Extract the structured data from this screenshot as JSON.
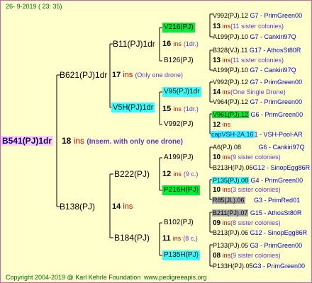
{
  "header": {
    "date": "26- 9-2019 ( 23: 35)"
  },
  "footer": {
    "copyright": "Copyright 2004-2019 @ Karl Kehrle Foundation",
    "site": "www.pedigreeapis.org"
  },
  "colors": {
    "background": "#ffffcc",
    "green_box": "#00ee33",
    "cyan_box": "#33ffff",
    "grey_box": "#aaaaaa",
    "pink_box": "#ffccff",
    "blue_text": "#0000cc",
    "red_text": "#cc0000",
    "purple_text": "#6633cc",
    "green_text": "#33aa33"
  },
  "root": {
    "name": "B541(PJ)1dr",
    "ins": "18",
    "ins_unit": "ins",
    "note": "(Insem. with only one drone)"
  },
  "gen1": [
    {
      "name": "B621(PJ)1dr",
      "ins": "17",
      "ins_unit": "ins",
      "note": "(Only one drone)"
    },
    {
      "name": "B138(PJ)",
      "ins": "14",
      "ins_unit": "ins",
      "note": ""
    }
  ],
  "gen2": [
    {
      "name": "B11(PJ)1dr",
      "ins": "16",
      "ins_unit": "ins",
      "note": "(1dr.)"
    },
    {
      "name": "V5H(PJ)1dr",
      "ins": "15",
      "ins_unit": "ins",
      "note": "(1dr.)"
    },
    {
      "name": "B222(PJ)",
      "ins": "12",
      "ins_unit": "ins",
      "note": "(9 c.)"
    },
    {
      "name": "B184(PJ)",
      "ins": "11",
      "ins_unit": "ins",
      "note": "(8 c.)"
    }
  ],
  "gen3": [
    {
      "name": "V216(PJ)",
      "ins": "13",
      "note": "(11 sister colonies)"
    },
    {
      "name": "B126(PJ)",
      "ins": "13",
      "note": "(11 sister colonies)"
    },
    {
      "name": "V95(PJ)1dr",
      "ins": "14",
      "note": "(One Single Drone)"
    },
    {
      "name": "V992(PJ)",
      "ins": "12",
      "note": ""
    },
    {
      "name": "A199(PJ)",
      "ins": "10",
      "note": "(9 sister colonies)"
    },
    {
      "name": "P216H(PJ)",
      "ins": "10",
      "note": "(3 sister colonies)"
    },
    {
      "name": "B102(PJ)",
      "ins": "09",
      "note": "(8 sister colonies)"
    },
    {
      "name": "P135H(PJ)",
      "ins": "08",
      "note": "(9 sister colonies)"
    }
  ],
  "gen4": [
    {
      "name": "V992(PJ).12",
      "info": "G7 - PrimGreen00"
    },
    {
      "name": "A199(PJ).10",
      "info": "G7 - Cankiri97Q"
    },
    {
      "name": "B328(VJ).11",
      "info": "G17 - AthosSt80R"
    },
    {
      "name": "A199(PJ).10",
      "info": "G7 - Cankiri97Q"
    },
    {
      "name": "V992(PJ).12",
      "info": "G7 - PrimGreen00"
    },
    {
      "name": "V964(PJ).12",
      "info": "G7 - PrimGreen00"
    },
    {
      "name": "V961(PJ).12",
      "info": "G6 - PrimGreen00"
    },
    {
      "name": "capVSH-2A.16",
      "info": "1 - VSH-Pool-AR"
    },
    {
      "name": "A6(PJ).08",
      "info": "G6 - Cankiri97Q"
    },
    {
      "name": "B213H(PJ).06",
      "info": "G12 - SinopEgg86R"
    },
    {
      "name": "P135(PJ).08",
      "info": "G4 - PrimGreen00"
    },
    {
      "name": "R85(JL).06",
      "info": "G3 - PrimRed01"
    },
    {
      "name": "B211(PJ).07",
      "info": "G15 - AthosSt80R"
    },
    {
      "name": "B213(PJ).06",
      "info": "G12 - SinopEgg86R"
    },
    {
      "name": "P133(PJ).05",
      "info": "G3 - PrimGreen00"
    },
    {
      "name": "P133H(PJ).05",
      "info": "G3 - PrimGreen00"
    }
  ]
}
